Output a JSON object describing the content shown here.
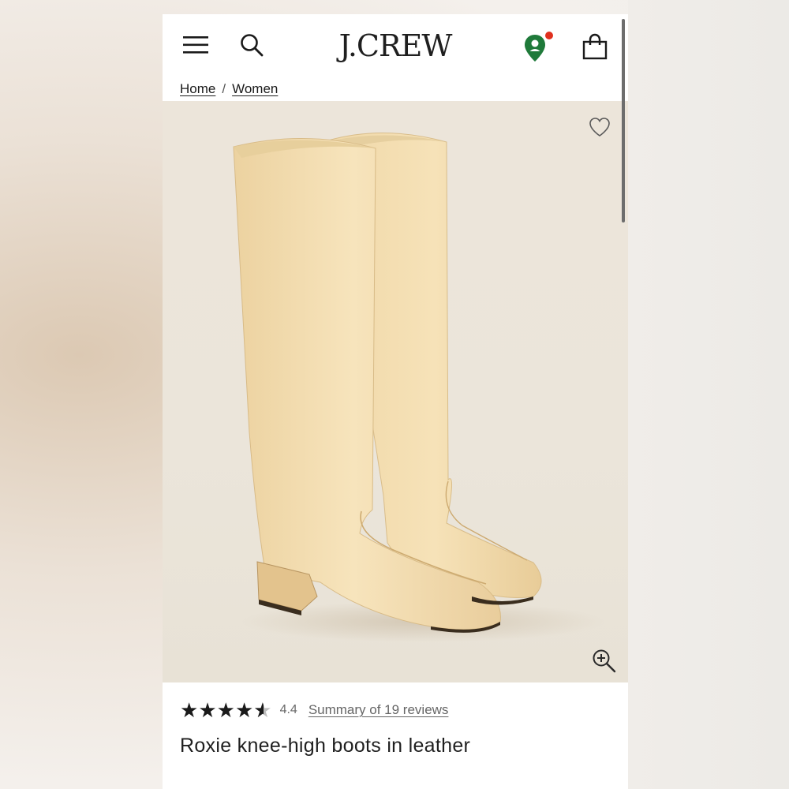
{
  "header": {
    "logo": "J.CREW",
    "icons": {
      "menu": "hamburger-menu-icon",
      "search": "search-icon",
      "location": "location-pin-icon",
      "bag": "shopping-bag-icon"
    },
    "location_badge_color": "#e0301e",
    "location_pin_color": "#1f7a3a"
  },
  "breadcrumb": {
    "items": [
      "Home",
      "Women"
    ],
    "separator": "/"
  },
  "product": {
    "image_subject": "cream leather knee-high boots",
    "wishlist_icon": "heart-outline-icon",
    "zoom_icon": "zoom-in-icon",
    "rating": {
      "stars_filled": 4.4,
      "stars_total": 5,
      "value_label": "4.4",
      "reviews_link": "Summary of 19 reviews"
    },
    "title": "Roxie knee-high boots in leather"
  }
}
